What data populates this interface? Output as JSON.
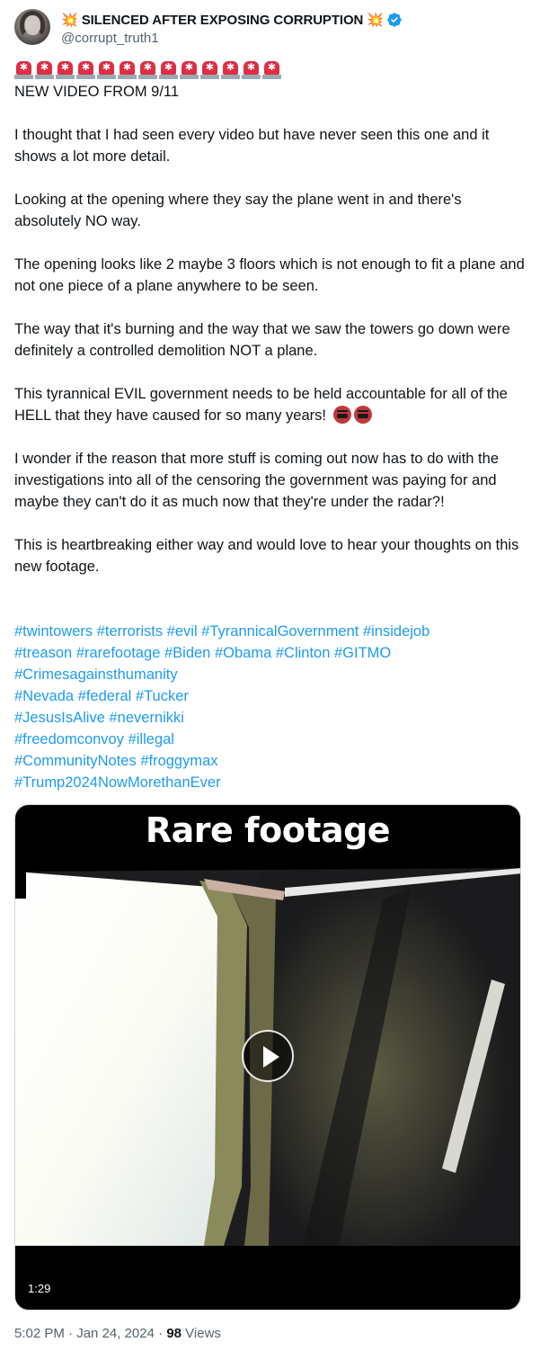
{
  "author": {
    "display_name": "SILENCED AFTER EXPOSING CORRUPTION",
    "name_decoration": "💥",
    "handle": "@corrupt_truth1",
    "verified": true,
    "verified_color": "#1d9bf0"
  },
  "post": {
    "siren_emoji": "🚨",
    "siren_count": 13,
    "paragraphs": [
      "NEW VIDEO FROM 9/11",
      "I thought that I had seen every video but have never seen this one and it shows a lot more detail.",
      "Looking at the opening where they say the plane went in and there's absolutely NO way.",
      "The opening looks like 2 maybe 3 floors which is not enough to fit a plane and not one piece of a plane anywhere to be seen.",
      "The way that it's burning and the way that we saw the towers go down were definitely a controlled demolition NOT a plane.",
      "This tyrannical EVIL government needs to be held accountable for all of the HELL that they have caused for so many years!",
      "I wonder if the reason that more stuff is coming out now has to do with the investigations into all of the censoring the government was paying for and maybe they can't do it as much now that they're under the radar?!",
      "This is heartbreaking either way and would love to hear your thoughts on this new footage."
    ],
    "hashtags": [
      [
        "#twintowers",
        "#terrorists",
        "#evil",
        "#TyrannicalGovernment",
        "#insidejob"
      ],
      [
        "#treason",
        "#rarefootage",
        "#Biden",
        "#Obama",
        "#Clinton",
        "#GITMO"
      ],
      [
        "#Crimesagainsthumanity"
      ],
      [
        "#Nevada",
        "#federal",
        "#Tucker"
      ],
      [
        "#JesusIsAlive",
        "#nevernikki"
      ],
      [
        "#freedomconvoy",
        "#illegal"
      ],
      [
        "#CommunityNotes",
        "#froggymax"
      ],
      [
        "#Trump2024NowMorethanEver"
      ]
    ],
    "link_color": "#1d9bf0"
  },
  "media": {
    "caption": "Rare footage",
    "duration": "1:29",
    "play_icon": "play-icon"
  },
  "meta": {
    "time": "5:02 PM",
    "separator": "·",
    "date": "Jan 24, 2024",
    "views_count": "98",
    "views_label": "Views"
  }
}
